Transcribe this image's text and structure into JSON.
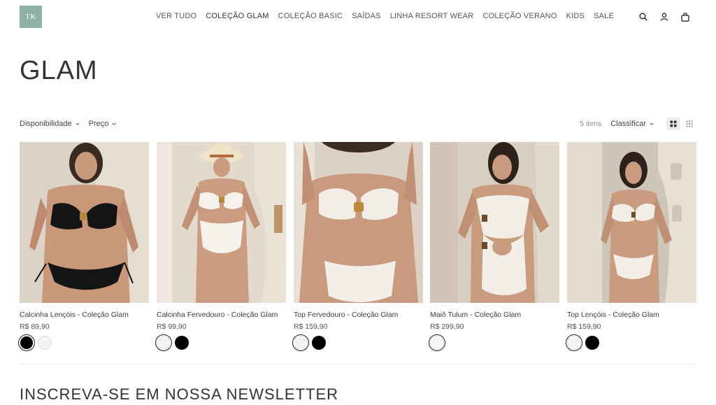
{
  "header": {
    "logo_text": "TK",
    "nav": [
      "VER TUDO",
      "COLEÇÃO GLAM",
      "COLEÇÃO BASIC",
      "SAÍDAS",
      "LINHA RESORT WEAR",
      "COLEÇÃO VERANO",
      "KIDS",
      "SALE"
    ],
    "icons": [
      "search-icon",
      "account-icon",
      "cart-icon"
    ]
  },
  "page": {
    "title": "GLAM"
  },
  "filters": {
    "availability": "Disponibilidade",
    "price": "Preço"
  },
  "toolbar": {
    "count": "5 itens",
    "sort": "Classificar"
  },
  "products": [
    {
      "name": "Calcinha Lençóis - Coleção Glam",
      "price": "R$ 89,90",
      "swatches": [
        "black",
        "white"
      ],
      "selected": 0,
      "garment": "black"
    },
    {
      "name": "Calcinha Fervedouro - Coleção Glam",
      "price": "R$ 99,90",
      "swatches": [
        "white",
        "black"
      ],
      "selected": 0,
      "garment": "white"
    },
    {
      "name": "Top Fervedouro - Coleção Glam",
      "price": "R$ 159,90",
      "swatches": [
        "white",
        "black"
      ],
      "selected": 0,
      "garment": "white"
    },
    {
      "name": "Maiô Tulum - Coleção Glam",
      "price": "R$ 299,90",
      "swatches": [
        "white"
      ],
      "selected": 0,
      "garment": "white"
    },
    {
      "name": "Top Lençóis - Coleção Glam",
      "price": "R$ 159,90",
      "swatches": [
        "white",
        "black"
      ],
      "selected": 0,
      "garment": "white"
    }
  ],
  "newsletter": {
    "title": "INSCREVA-SE EM NOSSA NEWSLETTER"
  },
  "colors": {
    "logo_bg": "#8fb0a6",
    "text": "#3a3a3a",
    "black_swatch": "#000000",
    "white_swatch": "#f4f4f4"
  }
}
